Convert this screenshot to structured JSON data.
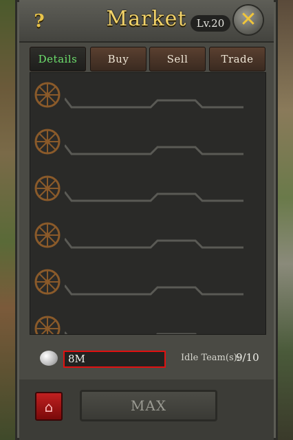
{
  "window": {
    "title": "Market",
    "level": "Lv.20",
    "help_glyph": "?",
    "close_glyph": "✕"
  },
  "tabs": [
    {
      "label": "Details",
      "active": true
    },
    {
      "label": "Buy",
      "active": false
    },
    {
      "label": "Sell",
      "active": false
    },
    {
      "label": "Trade",
      "active": false
    }
  ],
  "slots": [
    {
      "icon": "wagon-wheel-icon"
    },
    {
      "icon": "wagon-wheel-icon"
    },
    {
      "icon": "wagon-wheel-icon"
    },
    {
      "icon": "wagon-wheel-icon"
    },
    {
      "icon": "wagon-wheel-icon"
    },
    {
      "icon": "wagon-wheel-icon"
    }
  ],
  "resource": {
    "icon": "silver-coin-icon",
    "amount": "8M"
  },
  "idle": {
    "label": "Idle Team(s):",
    "value": "9/10"
  },
  "buttons": {
    "max": "MAX",
    "delete_icon": "house-delete-icon"
  },
  "colors": {
    "title": "#f2d36a",
    "active_tab": "#6de06d",
    "highlight_border": "#e01010"
  }
}
